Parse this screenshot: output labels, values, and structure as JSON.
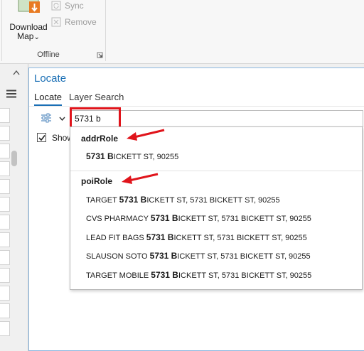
{
  "ribbon": {
    "download_map_label_line1": "Download",
    "download_map_label_line2": "Map",
    "download_map_chevron": "⌄",
    "sync_label": "Sync",
    "remove_label": "Remove",
    "group_label": "Offline",
    "icons": {
      "download_map": "download-map-icon",
      "sync": "sync-icon",
      "remove": "remove-icon",
      "launcher": "dialog-launcher-icon"
    }
  },
  "locate_pane": {
    "title": "Locate",
    "tabs": [
      {
        "label": "Locate",
        "active": true
      },
      {
        "label": "Layer Search",
        "active": false
      }
    ],
    "search": {
      "value": "5731 b"
    },
    "show_checkbox": {
      "label": "Show",
      "checked": true
    }
  },
  "suggestions": {
    "groups": [
      {
        "name": "addrRole",
        "items": [
          {
            "prefix": "",
            "bold": "5731 B",
            "rest": "ICKETT ST, 90255"
          }
        ]
      },
      {
        "name": "poiRole",
        "items": [
          {
            "prefix": "TARGET ",
            "bold": "5731 B",
            "rest": "ICKETT ST, 5731 BICKETT ST, 90255"
          },
          {
            "prefix": "CVS PHARMACY ",
            "bold": "5731 B",
            "rest": "ICKETT ST, 5731 BICKETT ST, 90255"
          },
          {
            "prefix": "LEAD FIT BAGS ",
            "bold": "5731 B",
            "rest": "ICKETT ST, 5731 BICKETT ST, 90255"
          },
          {
            "prefix": "SLAUSON SOTO ",
            "bold": "5731 B",
            "rest": "ICKETT ST, 5731 BICKETT ST, 90255"
          },
          {
            "prefix": "TARGET MOBILE ",
            "bold": "5731 B",
            "rest": "ICKETT ST, 5731 BICKETT ST, 90255"
          }
        ]
      }
    ]
  },
  "colors": {
    "accent": "#1a6fb5",
    "annotation_red": "#e0141b"
  }
}
